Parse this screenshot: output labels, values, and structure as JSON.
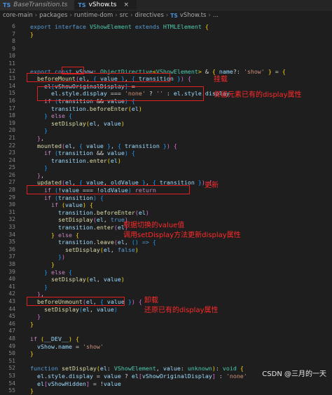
{
  "tabs": [
    {
      "icon": "TS",
      "label": "BaseTransition.ts",
      "close": ""
    },
    {
      "icon": "TS",
      "label": "vShow.ts",
      "close": "×"
    }
  ],
  "breadcrumb": {
    "parts": [
      "core-main",
      "packages",
      "runtime-dom",
      "src",
      "directives"
    ],
    "file_icon": "TS",
    "file": "vShow.ts",
    "symbol": "..."
  },
  "code_lines": [
    {
      "n": "6",
      "html": "  <span class=\"k\">export</span> <span class=\"k\">interface</span> <span class=\"t\">VShowElement</span> <span class=\"k\">extends</span> <span class=\"t\">HTMLElement</span> <span class=\"b\">{</span>"
    },
    {
      "n": "7",
      "html": "  <span class=\"b\">}</span>"
    },
    {
      "n": "8",
      "html": ""
    },
    {
      "n": "9",
      "html": ""
    },
    {
      "n": "10",
      "html": ""
    },
    {
      "n": "11",
      "html": ""
    },
    {
      "n": "12",
      "html": "  <span class=\"k\">export</span> <span class=\"k\">const</span> <span class=\"v\">vShow</span>: <span class=\"t\">ObjectDirective</span><span class=\"b\">&lt;</span><span class=\"t\">VShowElement</span><span class=\"b\">&gt;</span> &amp; <span class=\"b\">{</span> <span class=\"v\">name</span>?: <span class=\"s\">'show'</span> <span class=\"b\">}</span> = <span class=\"b\">{</span>"
    },
    {
      "n": "13",
      "html": "    <span class=\"f\">beforeMount</span><span class=\"b2\">(</span><span class=\"v\">el</span>, <span class=\"b3\">{</span> <span class=\"v\">value</span> <span class=\"b3\">}</span>, <span class=\"b3\">{</span> <span class=\"v\">transition</span> <span class=\"b3\">}</span><span class=\"b2\">)</span> <span class=\"b2\">{</span>"
    },
    {
      "n": "14",
      "html": "      <span class=\"v\">el</span><span class=\"b3\">[</span><span class=\"v\">vShowOriginalDisplay</span><span class=\"b3\">]</span> ="
    },
    {
      "n": "15",
      "html": "        <span class=\"v\">el</span>.<span class=\"v\">style</span>.<span class=\"v\">display</span> === <span class=\"s\">'none'</span> ? <span class=\"s\">''</span> : <span class=\"v\">el</span>.<span class=\"v\">style</span>.<span class=\"v\">display</span>"
    },
    {
      "n": "16",
      "html": "      <span class=\"c\">if</span> <span class=\"b3\">(</span><span class=\"v\">transition</span> &amp;&amp; <span class=\"v\">value</span><span class=\"b3\">)</span> <span class=\"b3\">{</span>"
    },
    {
      "n": "17",
      "html": "        <span class=\"v\">transition</span>.<span class=\"f\">beforeEnter</span><span class=\"b\">(</span><span class=\"v\">el</span><span class=\"b\">)</span>"
    },
    {
      "n": "18",
      "html": "      <span class=\"b3\">}</span> <span class=\"c\">else</span> <span class=\"b3\">{</span>"
    },
    {
      "n": "19",
      "html": "        <span class=\"f\">setDisplay</span><span class=\"b\">(</span><span class=\"v\">el</span>, <span class=\"v\">value</span><span class=\"b\">)</span>"
    },
    {
      "n": "20",
      "html": "      <span class=\"b3\">}</span>"
    },
    {
      "n": "21",
      "html": "    <span class=\"b2\">}</span>,"
    },
    {
      "n": "22",
      "html": "    <span class=\"f\">mounted</span><span class=\"b2\">(</span><span class=\"v\">el</span>, <span class=\"b3\">{</span> <span class=\"v\">value</span> <span class=\"b3\">}</span>, <span class=\"b3\">{</span> <span class=\"v\">transition</span> <span class=\"b3\">}</span><span class=\"b2\">)</span> <span class=\"b2\">{</span>"
    },
    {
      "n": "23",
      "html": "      <span class=\"c\">if</span> <span class=\"b3\">(</span><span class=\"v\">transition</span> &amp;&amp; <span class=\"v\">value</span><span class=\"b3\">)</span> <span class=\"b3\">{</span>"
    },
    {
      "n": "24",
      "html": "        <span class=\"v\">transition</span>.<span class=\"f\">enter</span><span class=\"b\">(</span><span class=\"v\">el</span><span class=\"b\">)</span>"
    },
    {
      "n": "25",
      "html": "      <span class=\"b3\">}</span>"
    },
    {
      "n": "26",
      "html": "    <span class=\"b2\">}</span>,"
    },
    {
      "n": "27",
      "html": "    <span class=\"f\">updated</span><span class=\"b2\">(</span><span class=\"v\">el</span>, <span class=\"b3\">{</span> <span class=\"v\">value</span>, <span class=\"v\">oldValue</span> <span class=\"b3\">}</span>, <span class=\"b3\">{</span> <span class=\"v\">transition</span> <span class=\"b3\">}</span><span class=\"b2\">)</span> <span class=\"b2\">{</span>"
    },
    {
      "n": "28",
      "html": "      <span class=\"c\">if</span> <span class=\"b3\">(</span>!<span class=\"v\">value</span> === !<span class=\"v\">oldValue</span><span class=\"b3\">)</span> <span class=\"c\">return</span>"
    },
    {
      "n": "29",
      "html": "      <span class=\"c\">if</span> <span class=\"b3\">(</span><span class=\"v\">transition</span><span class=\"b3\">)</span> <span class=\"b3\">{</span>"
    },
    {
      "n": "30",
      "html": "        <span class=\"c\">if</span> <span class=\"b\">(</span><span class=\"v\">value</span><span class=\"b\">)</span> <span class=\"b\">{</span>"
    },
    {
      "n": "31",
      "html": "          <span class=\"v\">transition</span>.<span class=\"f\">beforeEnter</span><span class=\"b2\">(</span><span class=\"v\">el</span><span class=\"b2\">)</span>"
    },
    {
      "n": "32",
      "html": "          <span class=\"f\">setDisplay</span><span class=\"b2\">(</span><span class=\"v\">el</span>, <span class=\"k\">true</span><span class=\"b2\">)</span>"
    },
    {
      "n": "33",
      "html": "          <span class=\"v\">transition</span>.<span class=\"f\">enter</span><span class=\"b2\">(</span><span class=\"v\">el</span><span class=\"b2\">)</span>"
    },
    {
      "n": "34",
      "html": "        <span class=\"b\">}</span> <span class=\"c\">else</span> <span class=\"b\">{</span>"
    },
    {
      "n": "35",
      "html": "          <span class=\"v\">transition</span>.<span class=\"f\">leave</span><span class=\"b2\">(</span><span class=\"v\">el</span>, <span class=\"b3\">()</span> <span class=\"k\">=&gt;</span> <span class=\"b3\">{</span>"
    },
    {
      "n": "36",
      "html": "            <span class=\"f\">setDisplay</span><span class=\"b\">(</span><span class=\"v\">el</span>, <span class=\"k\">false</span><span class=\"b\">)</span>"
    },
    {
      "n": "37",
      "html": "          <span class=\"b3\">}</span><span class=\"b2\">)</span>"
    },
    {
      "n": "38",
      "html": "        <span class=\"b\">}</span>"
    },
    {
      "n": "39",
      "html": "      <span class=\"b3\">}</span> <span class=\"c\">else</span> <span class=\"b3\">{</span>"
    },
    {
      "n": "40",
      "html": "        <span class=\"f\">setDisplay</span><span class=\"b\">(</span><span class=\"v\">el</span>, <span class=\"v\">value</span><span class=\"b\">)</span>"
    },
    {
      "n": "41",
      "html": "      <span class=\"b3\">}</span>"
    },
    {
      "n": "42",
      "html": "    <span class=\"b2\">}</span>,"
    },
    {
      "n": "43",
      "html": "    <span class=\"f\">beforeUnmount</span><span class=\"b2\">(</span><span class=\"v\">el</span>, <span class=\"b3\">{</span> <span class=\"v\">value</span> <span class=\"b3\">}</span><span class=\"b2\">)</span> <span class=\"b2\">{</span>"
    },
    {
      "n": "44",
      "html": "      <span class=\"f\">setDisplay</span><span class=\"b3\">(</span><span class=\"v\">el</span>, <span class=\"v\">value</span><span class=\"b3\">)</span>"
    },
    {
      "n": "45",
      "html": "    <span class=\"b2\">}</span>"
    },
    {
      "n": "46",
      "html": "  <span class=\"b\">}</span>"
    },
    {
      "n": "47",
      "html": ""
    },
    {
      "n": "48",
      "html": "  <span class=\"c\">if</span> <span class=\"b\">(</span><span class=\"v\">__DEV__</span><span class=\"b\">)</span> <span class=\"b\">{</span>"
    },
    {
      "n": "49",
      "html": "    <span class=\"v\">vShow</span>.<span class=\"v\">name</span> = <span class=\"s\">'show'</span>"
    },
    {
      "n": "50",
      "html": "  <span class=\"b\">}</span>"
    },
    {
      "n": "51",
      "html": ""
    },
    {
      "n": "52",
      "html": "  <span class=\"k\">function</span> <span class=\"f\">setDisplay</span><span class=\"b\">(</span><span class=\"v\">el</span>: <span class=\"t\">VShowElement</span>, <span class=\"v\">value</span>: <span class=\"t\">unknown</span><span class=\"b\">)</span>: <span class=\"t\">void</span> <span class=\"b\">{</span>"
    },
    {
      "n": "53",
      "html": "    <span class=\"v\">el</span>.<span class=\"v\">style</span>.<span class=\"v\">display</span> = <span class=\"v\">value</span> ? <span class=\"v\">el</span><span class=\"b2\">[</span><span class=\"v\">vShowOriginalDisplay</span><span class=\"b2\">]</span> : <span class=\"s\">'none'</span>"
    },
    {
      "n": "54",
      "html": "    <span class=\"v\">el</span><span class=\"b2\">[</span><span class=\"v\">vShowHidden</span><span class=\"b2\">]</span> = !<span class=\"v\">value</span>"
    },
    {
      "n": "55",
      "html": "  <span class=\"b\">}</span>"
    }
  ],
  "annotations": {
    "mount": "挂载",
    "preserve": "保留元素已有的display属性",
    "update": "更新",
    "update_detail_1": "根据切换的value值",
    "update_detail_2": "调用setDisplay方法更新display属性",
    "unmount": "卸载",
    "restore": "还原已有的display属性"
  },
  "watermark": "CSDN @三月的一天",
  "colors": {
    "annotation": "#ff2a2a",
    "keyword": "#569cd6",
    "control": "#c586c0",
    "type": "#4ec9b0",
    "function": "#dcdcaa",
    "variable": "#9cdcfe",
    "string": "#ce9178"
  }
}
